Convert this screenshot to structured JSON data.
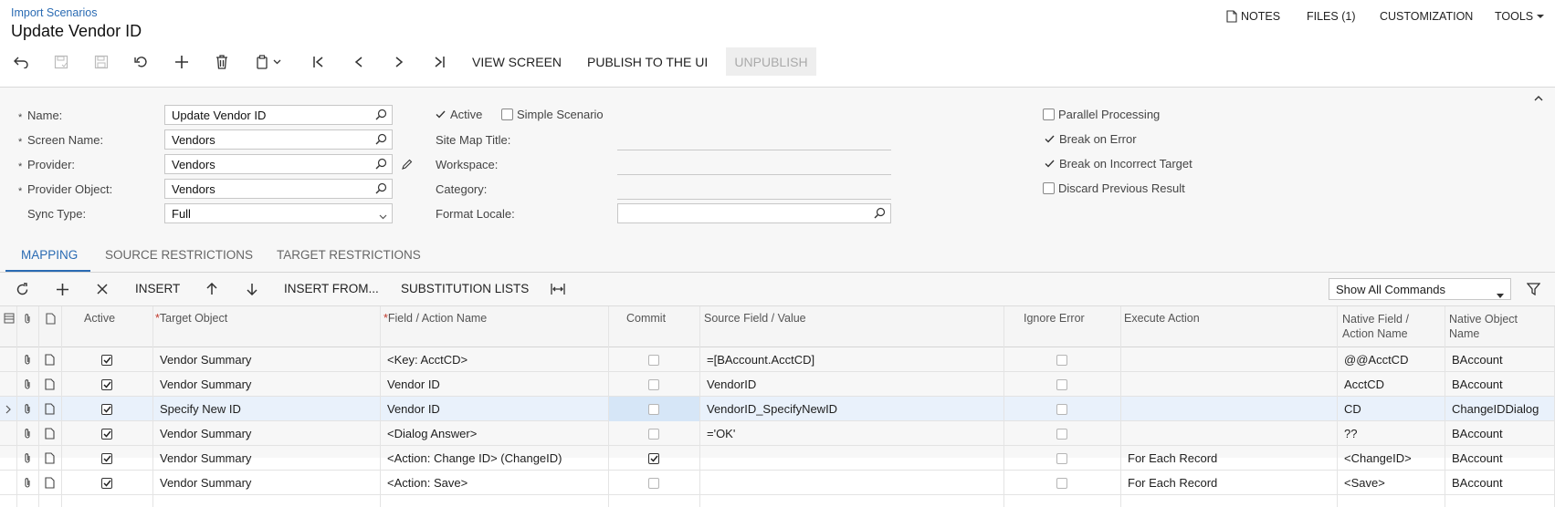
{
  "header": {
    "breadcrumb": "Import Scenarios",
    "title": "Update Vendor ID",
    "links": {
      "notes": "NOTES",
      "files": "FILES (1)",
      "customization": "CUSTOMIZATION",
      "tools": "TOOLS"
    }
  },
  "toolbar": {
    "view_screen": "VIEW SCREEN",
    "publish": "PUBLISH TO THE UI",
    "unpublish": "UNPUBLISH"
  },
  "form": {
    "name_label": "Name:",
    "name_value": "Update Vendor ID",
    "screen_name_label": "Screen Name:",
    "screen_name_value": "Vendors",
    "provider_label": "Provider:",
    "provider_value": "Vendors",
    "provider_object_label": "Provider Object:",
    "provider_object_value": "Vendors",
    "sync_type_label": "Sync Type:",
    "sync_type_value": "Full",
    "active_label": "Active",
    "simple_scenario_label": "Simple Scenario",
    "site_map_title_label": "Site Map Title:",
    "workspace_label": "Workspace:",
    "category_label": "Category:",
    "format_locale_label": "Format Locale:",
    "parallel_processing_label": "Parallel Processing",
    "break_on_error_label": "Break on Error",
    "break_on_incorrect_target_label": "Break on Incorrect Target",
    "discard_previous_result_label": "Discard Previous Result",
    "active": true,
    "simple_scenario": false,
    "parallel_processing": false,
    "break_on_error": true,
    "break_on_incorrect_target": true,
    "discard_previous_result": false
  },
  "tabs": {
    "mapping": "MAPPING",
    "source": "SOURCE RESTRICTIONS",
    "target": "TARGET RESTRICTIONS"
  },
  "grid_toolbar": {
    "insert": "INSERT",
    "insert_from": "INSERT FROM...",
    "substitution_lists": "SUBSTITUTION LISTS",
    "commands_value": "Show All Commands"
  },
  "grid": {
    "headers": {
      "active": "Active",
      "target_object": "Target Object",
      "field_action": "Field / Action Name",
      "commit": "Commit",
      "source_field": "Source Field / Value",
      "ignore_error": "Ignore Error",
      "execute_action": "Execute Action",
      "native_field_1": "Native Field /",
      "native_field_2": "Action Name",
      "native_object_1": "Native Object",
      "native_object_2": "Name"
    },
    "rows": [
      {
        "target": "Vendor Summary",
        "field": "<Key: AcctCD>",
        "commit": false,
        "source": "=[BAccount.AcctCD]",
        "ignore": false,
        "execute": "",
        "native_field": "@@AcctCD",
        "native_object": "BAccount"
      },
      {
        "target": "Vendor Summary",
        "field": "Vendor ID",
        "commit": false,
        "source": "VendorID",
        "ignore": false,
        "execute": "",
        "native_field": "AcctCD",
        "native_object": "BAccount"
      },
      {
        "target": "Specify New ID",
        "field": "Vendor ID",
        "commit": false,
        "source": "VendorID_SpecifyNewID",
        "ignore": false,
        "execute": "",
        "native_field": "CD",
        "native_object": "ChangeIDDialog"
      },
      {
        "target": "Vendor Summary",
        "field": "<Dialog Answer>",
        "commit": false,
        "source": "='OK'",
        "ignore": false,
        "execute": "",
        "native_field": "??",
        "native_object": "BAccount"
      },
      {
        "target": "Vendor Summary",
        "field": "<Action: Change ID> (ChangeID)",
        "commit": true,
        "source": "",
        "ignore": false,
        "execute": "For Each Record",
        "native_field": "<ChangeID>",
        "native_object": "BAccount"
      },
      {
        "target": "Vendor Summary",
        "field": "<Action: Save>",
        "commit": false,
        "source": "",
        "ignore": false,
        "execute": "For Each Record",
        "native_field": "<Save>",
        "native_object": "BAccount"
      }
    ]
  }
}
